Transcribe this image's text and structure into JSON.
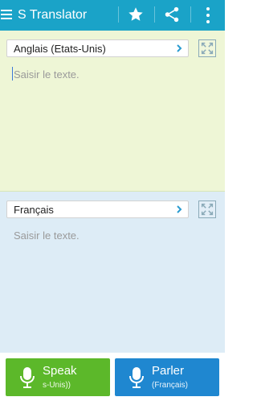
{
  "app": {
    "title": "S Translator",
    "icons": {
      "menu": "menu-icon",
      "favorite": "star-icon",
      "share": "share-icon",
      "more": "more-vert-icon"
    }
  },
  "source": {
    "language": "Anglais (Etats-Unis)",
    "placeholder": "Saisir le texte.",
    "background_color": "#eef6d6"
  },
  "target": {
    "language": "Français",
    "placeholder": "Saisir le texte.",
    "background_color": "#ddecf6"
  },
  "buttons": {
    "speak": {
      "label": "Speak",
      "sublabel": "s-Unis))",
      "color": "#5cb82a"
    },
    "parler": {
      "label": "Parler",
      "sublabel": "(Français)",
      "color": "#1f87d0"
    }
  },
  "accent_color": "#1aa3c8"
}
